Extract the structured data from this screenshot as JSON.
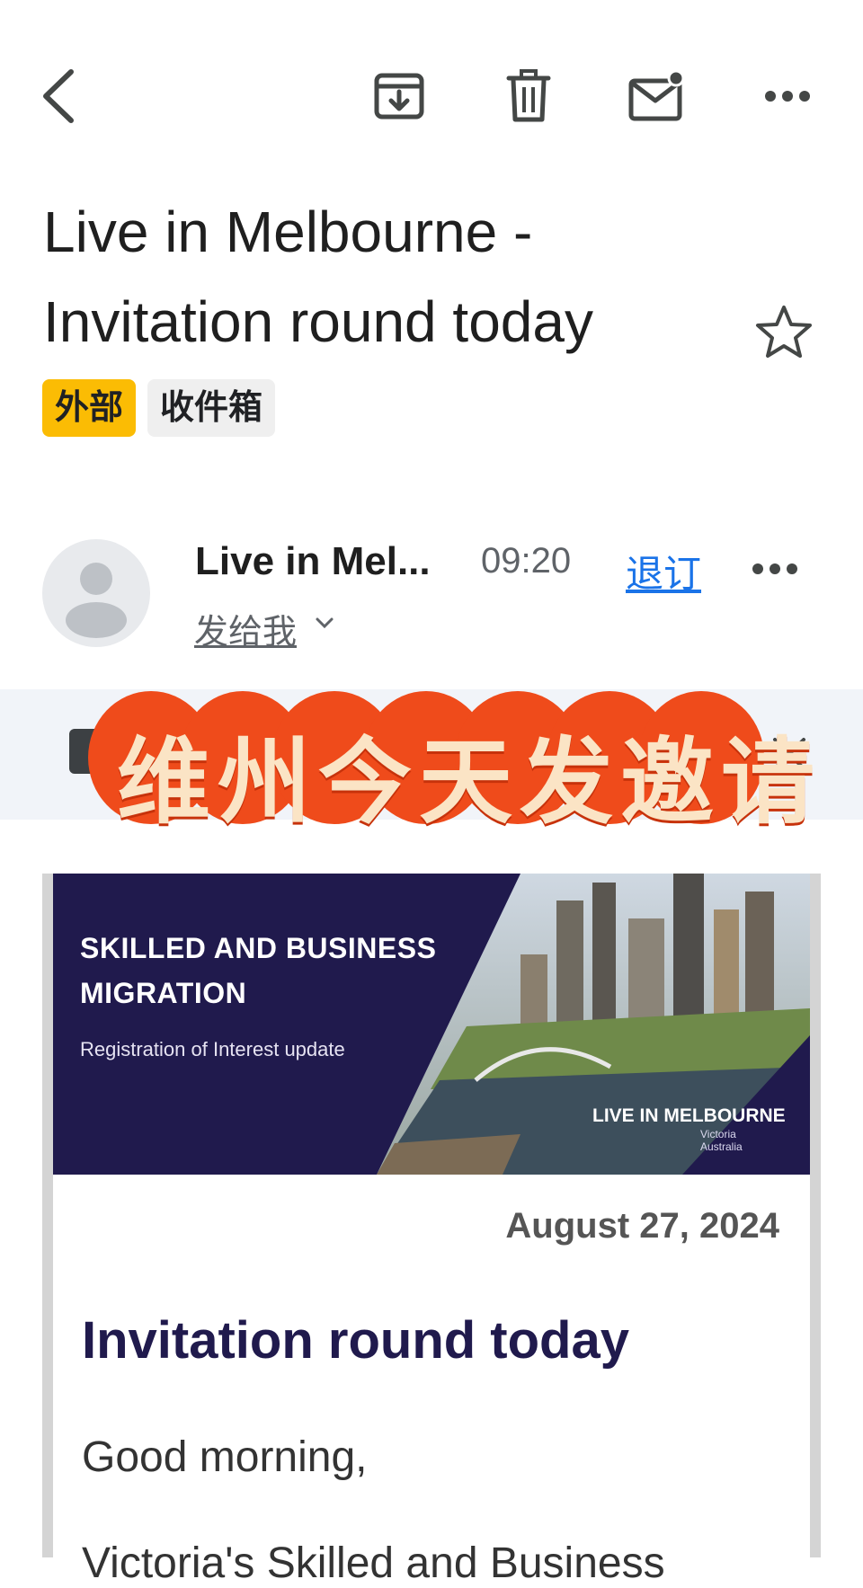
{
  "toolbar": {
    "back": "chevron-left-icon",
    "archive": "archive-icon",
    "delete": "trash-icon",
    "mark_unread": "mail-unread-icon",
    "more": "more-horizontal-icon"
  },
  "email": {
    "subject": "Live in Melbourne - Invitation round today",
    "labels": [
      "外部",
      "收件箱"
    ],
    "starred": false
  },
  "sender": {
    "name": "Live in Mel...",
    "time": "09:20",
    "unsubscribe_label": "退订",
    "recipient_label": "发给我"
  },
  "overlay": {
    "text": "维州今天发邀请"
  },
  "hero": {
    "title_line1": "SKILLED AND BUSINESS",
    "title_line2": "MIGRATION",
    "subtitle": "Registration of Interest update",
    "brand": "LIVE IN MELBOURNE",
    "brand_sub": "Victoria Australia"
  },
  "body": {
    "date": "August 27, 2024",
    "heading": "Invitation round today",
    "greeting": "Good morning,",
    "paragraph_start": "Victoria's Skilled and Business"
  },
  "colors": {
    "label_external": "#fbbc04",
    "label_inbox": "#efefef",
    "link": "#1a73e8",
    "overlay_red": "#ef4b1b",
    "overlay_text": "#fbe4c5",
    "hero_navy": "#201a4d"
  }
}
